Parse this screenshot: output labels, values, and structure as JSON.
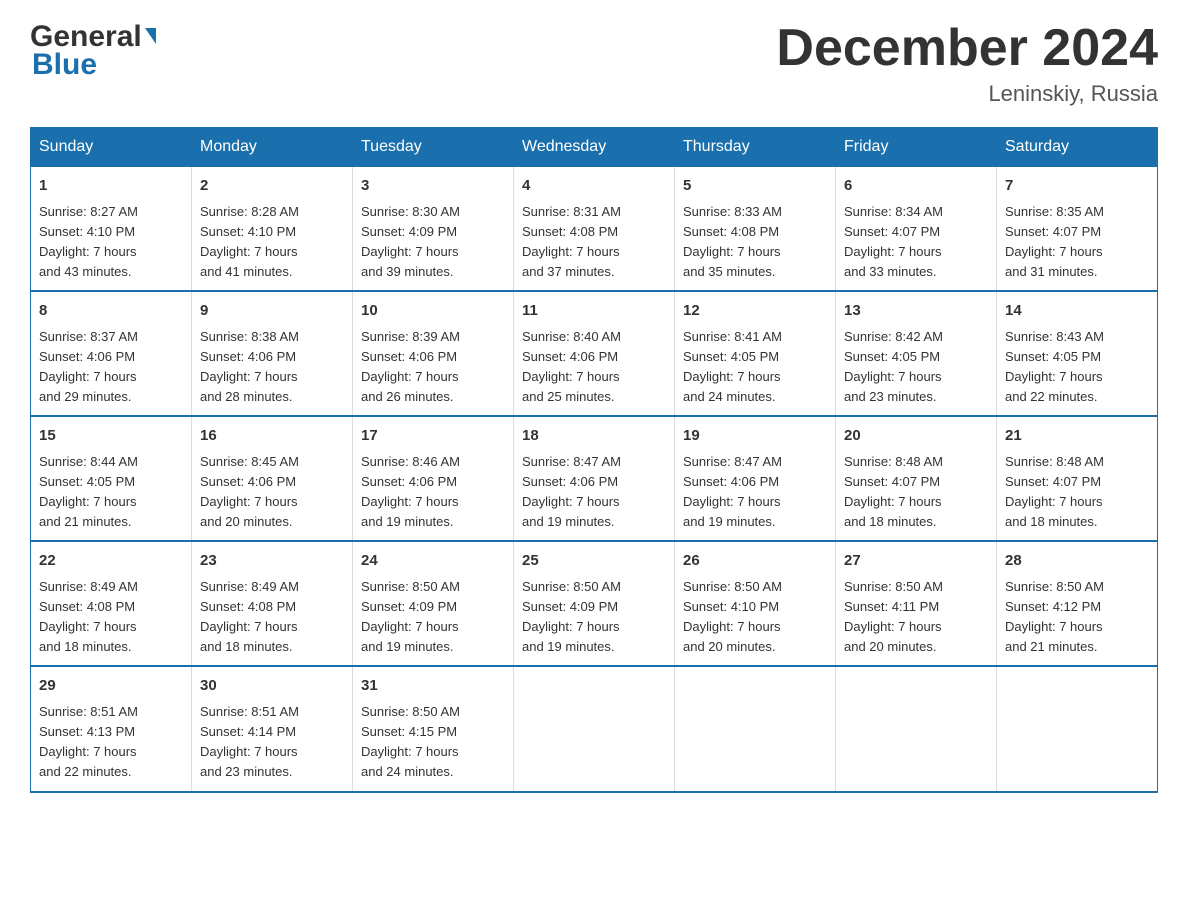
{
  "header": {
    "logo_general": "General",
    "logo_blue": "Blue",
    "month_title": "December 2024",
    "location": "Leninskiy, Russia"
  },
  "days_of_week": [
    "Sunday",
    "Monday",
    "Tuesday",
    "Wednesday",
    "Thursday",
    "Friday",
    "Saturday"
  ],
  "weeks": [
    [
      {
        "day": "1",
        "sunrise": "8:27 AM",
        "sunset": "4:10 PM",
        "daylight_hours": "7",
        "daylight_minutes": "43"
      },
      {
        "day": "2",
        "sunrise": "8:28 AM",
        "sunset": "4:10 PM",
        "daylight_hours": "7",
        "daylight_minutes": "41"
      },
      {
        "day": "3",
        "sunrise": "8:30 AM",
        "sunset": "4:09 PM",
        "daylight_hours": "7",
        "daylight_minutes": "39"
      },
      {
        "day": "4",
        "sunrise": "8:31 AM",
        "sunset": "4:08 PM",
        "daylight_hours": "7",
        "daylight_minutes": "37"
      },
      {
        "day": "5",
        "sunrise": "8:33 AM",
        "sunset": "4:08 PM",
        "daylight_hours": "7",
        "daylight_minutes": "35"
      },
      {
        "day": "6",
        "sunrise": "8:34 AM",
        "sunset": "4:07 PM",
        "daylight_hours": "7",
        "daylight_minutes": "33"
      },
      {
        "day": "7",
        "sunrise": "8:35 AM",
        "sunset": "4:07 PM",
        "daylight_hours": "7",
        "daylight_minutes": "31"
      }
    ],
    [
      {
        "day": "8",
        "sunrise": "8:37 AM",
        "sunset": "4:06 PM",
        "daylight_hours": "7",
        "daylight_minutes": "29"
      },
      {
        "day": "9",
        "sunrise": "8:38 AM",
        "sunset": "4:06 PM",
        "daylight_hours": "7",
        "daylight_minutes": "28"
      },
      {
        "day": "10",
        "sunrise": "8:39 AM",
        "sunset": "4:06 PM",
        "daylight_hours": "7",
        "daylight_minutes": "26"
      },
      {
        "day": "11",
        "sunrise": "8:40 AM",
        "sunset": "4:06 PM",
        "daylight_hours": "7",
        "daylight_minutes": "25"
      },
      {
        "day": "12",
        "sunrise": "8:41 AM",
        "sunset": "4:05 PM",
        "daylight_hours": "7",
        "daylight_minutes": "24"
      },
      {
        "day": "13",
        "sunrise": "8:42 AM",
        "sunset": "4:05 PM",
        "daylight_hours": "7",
        "daylight_minutes": "23"
      },
      {
        "day": "14",
        "sunrise": "8:43 AM",
        "sunset": "4:05 PM",
        "daylight_hours": "7",
        "daylight_minutes": "22"
      }
    ],
    [
      {
        "day": "15",
        "sunrise": "8:44 AM",
        "sunset": "4:05 PM",
        "daylight_hours": "7",
        "daylight_minutes": "21"
      },
      {
        "day": "16",
        "sunrise": "8:45 AM",
        "sunset": "4:06 PM",
        "daylight_hours": "7",
        "daylight_minutes": "20"
      },
      {
        "day": "17",
        "sunrise": "8:46 AM",
        "sunset": "4:06 PM",
        "daylight_hours": "7",
        "daylight_minutes": "19"
      },
      {
        "day": "18",
        "sunrise": "8:47 AM",
        "sunset": "4:06 PM",
        "daylight_hours": "7",
        "daylight_minutes": "19"
      },
      {
        "day": "19",
        "sunrise": "8:47 AM",
        "sunset": "4:06 PM",
        "daylight_hours": "7",
        "daylight_minutes": "19"
      },
      {
        "day": "20",
        "sunrise": "8:48 AM",
        "sunset": "4:07 PM",
        "daylight_hours": "7",
        "daylight_minutes": "18"
      },
      {
        "day": "21",
        "sunrise": "8:48 AM",
        "sunset": "4:07 PM",
        "daylight_hours": "7",
        "daylight_minutes": "18"
      }
    ],
    [
      {
        "day": "22",
        "sunrise": "8:49 AM",
        "sunset": "4:08 PM",
        "daylight_hours": "7",
        "daylight_minutes": "18"
      },
      {
        "day": "23",
        "sunrise": "8:49 AM",
        "sunset": "4:08 PM",
        "daylight_hours": "7",
        "daylight_minutes": "18"
      },
      {
        "day": "24",
        "sunrise": "8:50 AM",
        "sunset": "4:09 PM",
        "daylight_hours": "7",
        "daylight_minutes": "19"
      },
      {
        "day": "25",
        "sunrise": "8:50 AM",
        "sunset": "4:09 PM",
        "daylight_hours": "7",
        "daylight_minutes": "19"
      },
      {
        "day": "26",
        "sunrise": "8:50 AM",
        "sunset": "4:10 PM",
        "daylight_hours": "7",
        "daylight_minutes": "20"
      },
      {
        "day": "27",
        "sunrise": "8:50 AM",
        "sunset": "4:11 PM",
        "daylight_hours": "7",
        "daylight_minutes": "20"
      },
      {
        "day": "28",
        "sunrise": "8:50 AM",
        "sunset": "4:12 PM",
        "daylight_hours": "7",
        "daylight_minutes": "21"
      }
    ],
    [
      {
        "day": "29",
        "sunrise": "8:51 AM",
        "sunset": "4:13 PM",
        "daylight_hours": "7",
        "daylight_minutes": "22"
      },
      {
        "day": "30",
        "sunrise": "8:51 AM",
        "sunset": "4:14 PM",
        "daylight_hours": "7",
        "daylight_minutes": "23"
      },
      {
        "day": "31",
        "sunrise": "8:50 AM",
        "sunset": "4:15 PM",
        "daylight_hours": "7",
        "daylight_minutes": "24"
      },
      null,
      null,
      null,
      null
    ]
  ],
  "labels": {
    "sunrise": "Sunrise:",
    "sunset": "Sunset:",
    "daylight": "Daylight: 7 hours"
  }
}
